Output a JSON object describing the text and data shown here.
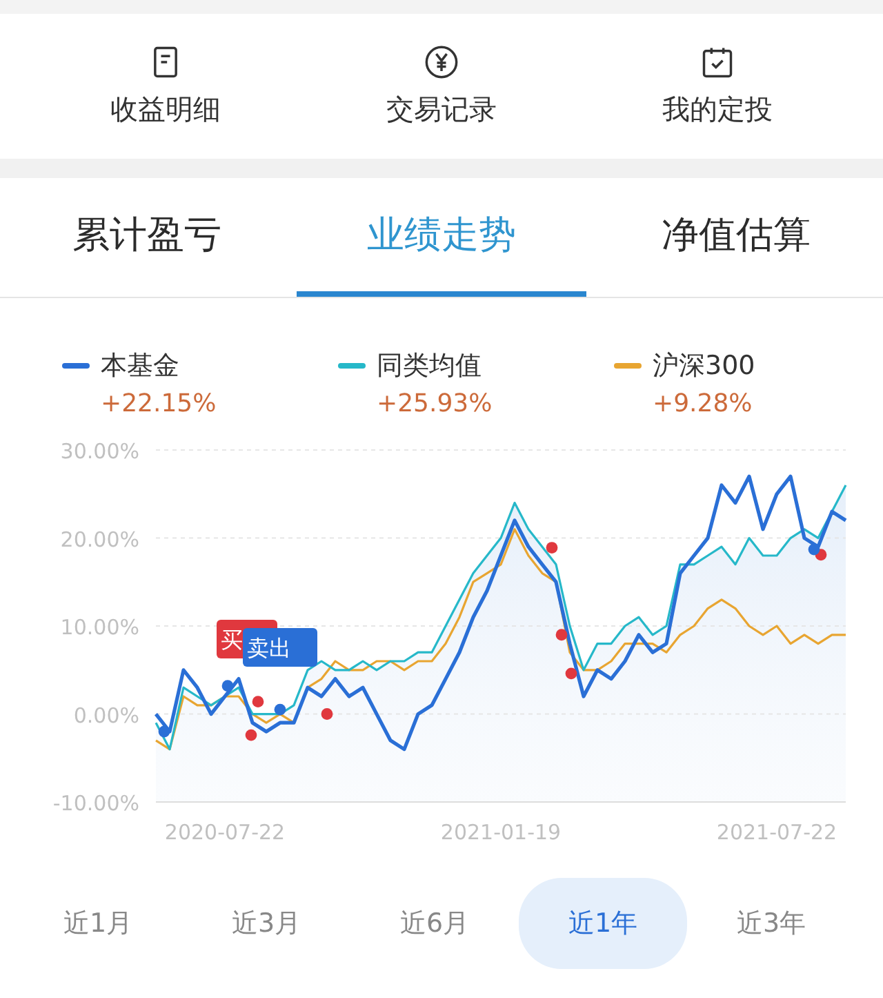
{
  "shortcuts": [
    {
      "kind": "document",
      "label": "收益明细"
    },
    {
      "kind": "yen",
      "label": "交易记录"
    },
    {
      "kind": "calendar",
      "label": "我的定投"
    }
  ],
  "tabs": [
    {
      "label": "累计盈亏",
      "selected": false
    },
    {
      "label": "业绩走势",
      "selected": true
    },
    {
      "label": "净值估算",
      "selected": false
    }
  ],
  "legend_changes": [
    "+22.15%",
    "+25.93%",
    "+9.28%"
  ],
  "chart_data": {
    "type": "line",
    "categories": [
      null,
      null,
      null,
      null,
      null,
      "2020-07-22",
      null,
      null,
      null,
      null,
      null,
      null,
      null,
      null,
      null,
      null,
      null,
      null,
      null,
      null,
      null,
      null,
      null,
      null,
      null,
      "2021-01-19",
      null,
      null,
      null,
      null,
      null,
      null,
      null,
      null,
      null,
      null,
      null,
      null,
      null,
      null,
      null,
      null,
      null,
      null,
      null,
      "2021-07-22",
      null,
      null,
      null,
      null,
      null
    ],
    "series": [
      {
        "name": "本基金",
        "color": "#2a6fd6",
        "values": [
          0,
          -2,
          5,
          3,
          0,
          2,
          4,
          -1,
          -2,
          -1,
          -1,
          3,
          2,
          4,
          2,
          3,
          0,
          -3,
          -4,
          0,
          1,
          4,
          7,
          11,
          14,
          18,
          22,
          19,
          17,
          15,
          8,
          2,
          5,
          4,
          6,
          9,
          7,
          8,
          16,
          18,
          20,
          26,
          24,
          27,
          21,
          25,
          27,
          20,
          19,
          23,
          22
        ]
      },
      {
        "name": "同类均值",
        "color": "#26b8c9",
        "values": [
          -1,
          -4,
          3,
          2,
          1,
          2,
          3,
          0,
          0,
          0,
          1,
          5,
          6,
          5,
          5,
          6,
          5,
          6,
          6,
          7,
          7,
          10,
          13,
          16,
          18,
          20,
          24,
          21,
          19,
          17,
          10,
          5,
          8,
          8,
          10,
          11,
          9,
          10,
          17,
          17,
          18,
          19,
          17,
          20,
          18,
          18,
          20,
          21,
          20,
          23,
          26
        ]
      },
      {
        "name": "沪深300",
        "color": "#e8a531",
        "values": [
          -3,
          -4,
          2,
          1,
          1,
          2,
          2,
          0,
          -1,
          0,
          -1,
          3,
          4,
          6,
          5,
          5,
          6,
          6,
          5,
          6,
          6,
          8,
          11,
          15,
          16,
          17,
          21,
          18,
          16,
          15,
          7,
          5,
          5,
          6,
          8,
          8,
          8,
          7,
          9,
          10,
          12,
          13,
          12,
          10,
          9,
          10,
          8,
          9,
          8,
          9,
          9
        ]
      }
    ],
    "ylim": [
      -10,
      30
    ],
    "yticks": [
      {
        "value": 30,
        "label": "30.00%"
      },
      {
        "value": 20,
        "label": "20.00%"
      },
      {
        "value": 10,
        "label": "10.00%"
      },
      {
        "value": 0,
        "label": "0.00%"
      },
      {
        "value": -10,
        "label": "-10.00%"
      }
    ],
    "grid": true
  },
  "trade_tags": [
    {
      "kind": "buy",
      "label": "买"
    },
    {
      "kind": "sell",
      "label": "卖出"
    }
  ],
  "periods": [
    {
      "label": "近1月",
      "selected": false
    },
    {
      "label": "近3月",
      "selected": false
    },
    {
      "label": "近6月",
      "selected": false
    },
    {
      "label": "近1年",
      "selected": true
    },
    {
      "label": "近3年",
      "selected": false
    }
  ]
}
